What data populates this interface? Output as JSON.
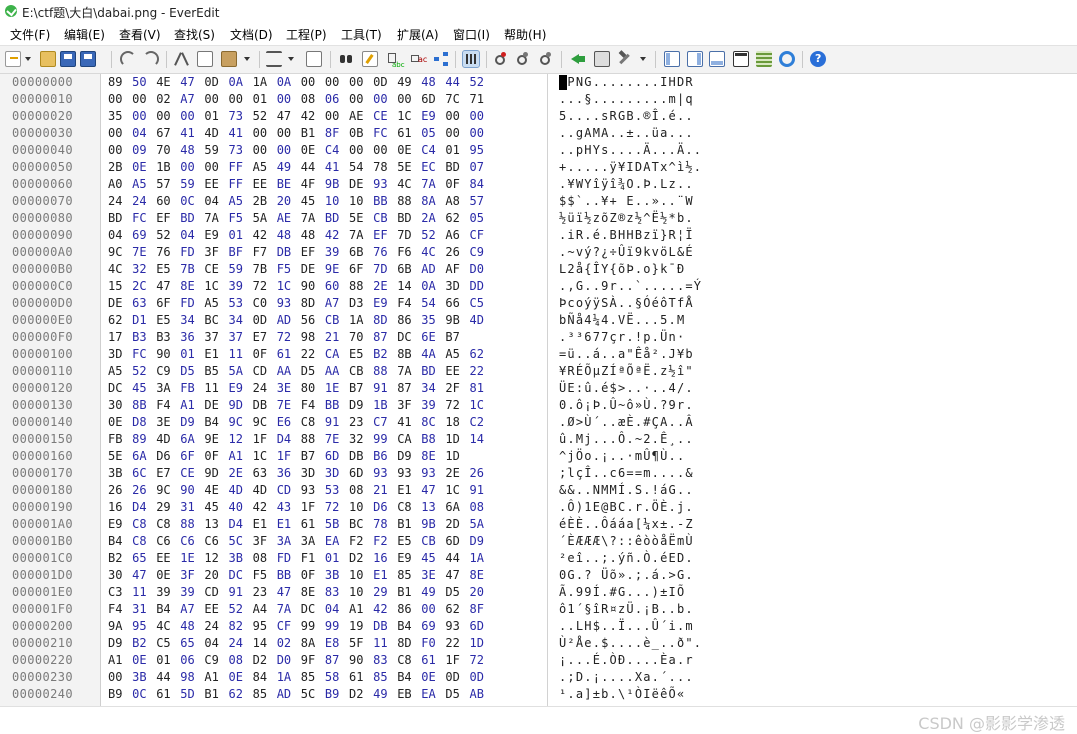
{
  "window": {
    "title": "E:\\ctf题\\大白\\dabai.png - EverEdit"
  },
  "menu": [
    "文件(F)",
    "编辑(E)",
    "查看(V)",
    "查找(S)",
    "文档(D)",
    "工程(P)",
    "工具(T)",
    "扩展(A)",
    "窗口(I)",
    "帮助(H)"
  ],
  "toolbar": {
    "buttons": [
      "new-file",
      "open-folder",
      "save",
      "save-all",
      "undo",
      "redo",
      "cut",
      "copy",
      "paste",
      "format",
      "word-wrap",
      "find",
      "replace",
      "find-in-files",
      "binary-view",
      "bookmark",
      "bookmark-prev",
      "bookmark-next",
      "run",
      "print",
      "tools",
      "panel-1",
      "panel-2",
      "panel-3",
      "terminal",
      "hex-grid",
      "browser",
      "help"
    ],
    "active": "binary-view"
  },
  "colors": {
    "hex_blue": "#2a2aa8",
    "hex_black": "#222222",
    "addr_gray": "#7a7a7a"
  },
  "rows": [
    {
      "addr": "00000000",
      "hex": "89 50 4E 47 0D 0A 1A 0A 00 00 00 0D 49 48 44 52",
      "blue": "0101010100000111",
      "ascii": ".PNG........IHDR"
    },
    {
      "addr": "00000010",
      "hex": "00 00 02 A7 00 00 01 00 08 06 00 00 00 6D 7C 71",
      "blue": "0001000101010000",
      "ascii": "...§.........m|q"
    },
    {
      "addr": "00000020",
      "hex": "35 00 00 00 01 73 52 47 42 00 AE CE 1C E9 00 00",
      "blue": "0101010000010101",
      "ascii": "5....sRGB.®Î.é.."
    },
    {
      "addr": "00000030",
      "hex": "00 04 67 41 4D 41 00 00 B1 8F 0B FC 61 05 00 00",
      "blue": "0101010001010101",
      "ascii": "..gAMA..±..üa..."
    },
    {
      "addr": "00000040",
      "hex": "00 09 70 48 59 73 00 00 0E C4 00 00 0E C4 01 95",
      "blue": "0101010101000101",
      "ascii": "..pHYs....Ä...Ä.."
    },
    {
      "addr": "00000050",
      "hex": "2B 0E 1B 00 00 FF A5 49 44 41 54 78 5E EC BD 07",
      "blue": "0101010101000101",
      "ascii": "+.....ÿ¥IDATx^ì½."
    },
    {
      "addr": "00000060",
      "hex": "A0 A5 57 59 EE FF EE BE 4F 9B DE 93 4C 7A 0F 84",
      "blue": "0101010101010101",
      "ascii": ".¥WYîÿî¾O.Þ.Lz.."
    },
    {
      "addr": "00000070",
      "hex": "24 24 60 0C 04 A5 2B 20 45 10 10 BB 88 8A A8 57",
      "blue": "0101010101010101",
      "ascii": "$$`..¥+ E..»..¨W"
    },
    {
      "addr": "00000080",
      "hex": "BD FC EF BD 7A F5 5A AE 7A BD 5E CB BD 2A 62 05",
      "blue": "0101010101010101",
      "ascii": "½üï½zõZ®z½^Ë½*b."
    },
    {
      "addr": "00000090",
      "hex": "04 69 52 04 E9 01 42 48 48 42 7A EF 7D 52 A6 CF",
      "blue": "0101010101010101",
      "ascii": ".iR.é.BHHBzï}R¦Ï"
    },
    {
      "addr": "000000A0",
      "hex": "9C 7E 76 FD 3F BF F7 DB EF 39 6B 76 F6 4C 26 C9",
      "blue": "0101010101010101",
      "ascii": ".~vý?¿÷Ûï9kvöL&É"
    },
    {
      "addr": "000000B0",
      "hex": "4C 32 E5 7B CE 59 7B F5 DE 9E 6F 7D 6B AD AF D0",
      "blue": "0101010101010101",
      "ascii": "L2å{ÎY{õÞ.o}k­¯Ð"
    },
    {
      "addr": "000000C0",
      "hex": "15 2C 47 8E 1C 39 72 1C 90 60 88 2E 14 0A 3D DD",
      "blue": "0101010101010101",
      "ascii": ".,G..9r..`.....=Ý"
    },
    {
      "addr": "000000D0",
      "hex": "DE 63 6F FD A5 53 C0 93 8D A7 D3 E9 F4 54 66 C5",
      "blue": "0101010101010101",
      "ascii": "ÞcoýÿSÀ..§ÓéôTfÅ"
    },
    {
      "addr": "000000E0",
      "hex": "62 D1 E5 34 BC 34 0D AD 56 CB 1A 8D 86 35 9B 4D",
      "blue": "0101010101010101",
      "ascii": "bÑå4¼4.­VË...5.M"
    },
    {
      "addr": "000000F0",
      "hex": "17 B3 B3 36 37 37 E7 72 98 21 70 87 DC 6E B7",
      "blue": "010101010101010",
      "ascii": ".³³677çr.!p.Ün·"
    },
    {
      "addr": "00000100",
      "hex": "3D FC 90 01 E1 11 0F 61 22 CA E5 B2 8B 4A A5 62",
      "blue": "0101010101010101",
      "ascii": "=ü..á..a\"Êå².J¥b"
    },
    {
      "addr": "00000110",
      "hex": "A5 52 C9 D5 B5 5A CD AA D5 AA CB 88 7A BD EE 22",
      "blue": "0101010101010101",
      "ascii": "¥RÉÕµZÍªÕªË.z½î\""
    },
    {
      "addr": "00000120",
      "hex": "DC 45 3A FB 11 E9 24 3E 80 1E B7 91 87 34 2F 81",
      "blue": "0101010101010101",
      "ascii": "ÜE:û.é$>..·..4/."
    },
    {
      "addr": "00000130",
      "hex": "30 8B F4 A1 DE 9D DB 7E F4 BB D9 1B 3F 39 72 1C",
      "blue": "0101010101010101",
      "ascii": "0.ô¡Þ.Û~ô»Ù.?9r."
    },
    {
      "addr": "00000140",
      "hex": "0E D8 3E D9 B4 9C 9C E6 C8 91 23 C7 41 8C 18 C2",
      "blue": "0101010101010101",
      "ascii": ".Ø>Ù´..æÈ.#ÇA..Â"
    },
    {
      "addr": "00000150",
      "hex": "FB 89 4D 6A 9E 12 1F D4 88 7E 32 99 CA B8 1D 14",
      "blue": "0101010101010101",
      "ascii": "û.Mj...Ô.~2.Ê¸.."
    },
    {
      "addr": "00000160",
      "hex": "5E 6A D6 6F 0F A1 1C 1F B7 6D DB B6 D9 8E 1D",
      "blue": "010101010101010",
      "ascii": "^jÖo.¡..·mÛ¶Ù.."
    },
    {
      "addr": "00000170",
      "hex": "3B 6C E7 CE 9D 2E 63 36 3D 3D 6D 93 93 93 2E 26",
      "blue": "0101010101010101",
      "ascii": ";lçÎ..c6==m....&"
    },
    {
      "addr": "00000180",
      "hex": "26 26 9C 90 4E 4D 4D CD 93 53 08 21 E1 47 1C 91",
      "blue": "0101010101010101",
      "ascii": "&&..NMMÍ.S.!áG.."
    },
    {
      "addr": "00000190",
      "hex": "16 D4 29 31 45 40 42 43 1F 72 10 D6 C8 13 6A 08",
      "blue": "0101010101010101",
      "ascii": ".Ô)1E@BC.r.ÖÈ.j."
    },
    {
      "addr": "000001A0",
      "hex": "E9 C8 C8 88 13 D4 E1 E1 61 5B BC 78 B1 9B 2D 5A",
      "blue": "0101010101010101",
      "ascii": "éÈÈ..Ôááa[¼x±.-Z"
    },
    {
      "addr": "000001B0",
      "hex": "B4 C8 C6 C6 C6 5C 3F 3A 3A EA F2 F2 E5 CB 6D D9",
      "blue": "0101010101010101",
      "ascii": "´ÈÆÆÆ\\?::êòòåËmÙ"
    },
    {
      "addr": "000001C0",
      "hex": "B2 65 EE 1E 12 3B 08 FD F1 01 D2 16 E9 45 44 1A",
      "blue": "0101010101010101",
      "ascii": "²eî..;.ýñ.Ò.éED."
    },
    {
      "addr": "000001D0",
      "hex": "30 47 0E 3F 20 DC F5 BB 0F 3B 10 E1 85 3E 47 8E",
      "blue": "0101010101010101",
      "ascii": "0G.? Üõ».;.á.>G."
    },
    {
      "addr": "000001E0",
      "hex": "C3 11 39 39 CD 91 23 47 8E 83 10 29 B1 49 D5 20",
      "blue": "0101010101010101",
      "ascii": "Ã.99Í.#G...)±IÕ "
    },
    {
      "addr": "000001F0",
      "hex": "F4 31 B4 A7 EE 52 A4 7A DC 04 A1 42 86 00 62 8F",
      "blue": "0101010101010101",
      "ascii": "ô1´§îR¤zÜ.¡B..b."
    },
    {
      "addr": "00000200",
      "hex": "9A 95 4C 48 24 82 95 CF 99 99 19 DB B4 69 93 6D",
      "blue": "0101010101010101",
      "ascii": "..LH$..Ï...Û´i.m"
    },
    {
      "addr": "00000210",
      "hex": "D9 B2 C5 65 04 24 14 02 8A E8 5F 11 8D F0 22 1D",
      "blue": "0101010101010101",
      "ascii": "Ù²Åe.$....è_..ð\"."
    },
    {
      "addr": "00000220",
      "hex": "A1 0E 01 06 C9 08 D2 D0 9F 87 90 83 C8 61 1F 72",
      "blue": "0101010101010101",
      "ascii": "¡...É.ÒÐ....Èa.r"
    },
    {
      "addr": "00000230",
      "hex": "00 3B 44 98 A1 0E 84 1A 85 58 61 85 B4 0E 0D 0D",
      "blue": "0101010101010101",
      "ascii": ".;D.¡....Xa.´..."
    },
    {
      "addr": "00000240",
      "hex": "B9 0C 61 5D B1 62 85 AD 5C B9 D2 49 EB EA D5 AB",
      "blue": "0101010101010101",
      "ascii": "¹.a]±b.­\\¹ÒIëêÕ«"
    }
  ],
  "watermark": "CSDN @影影学渗透"
}
